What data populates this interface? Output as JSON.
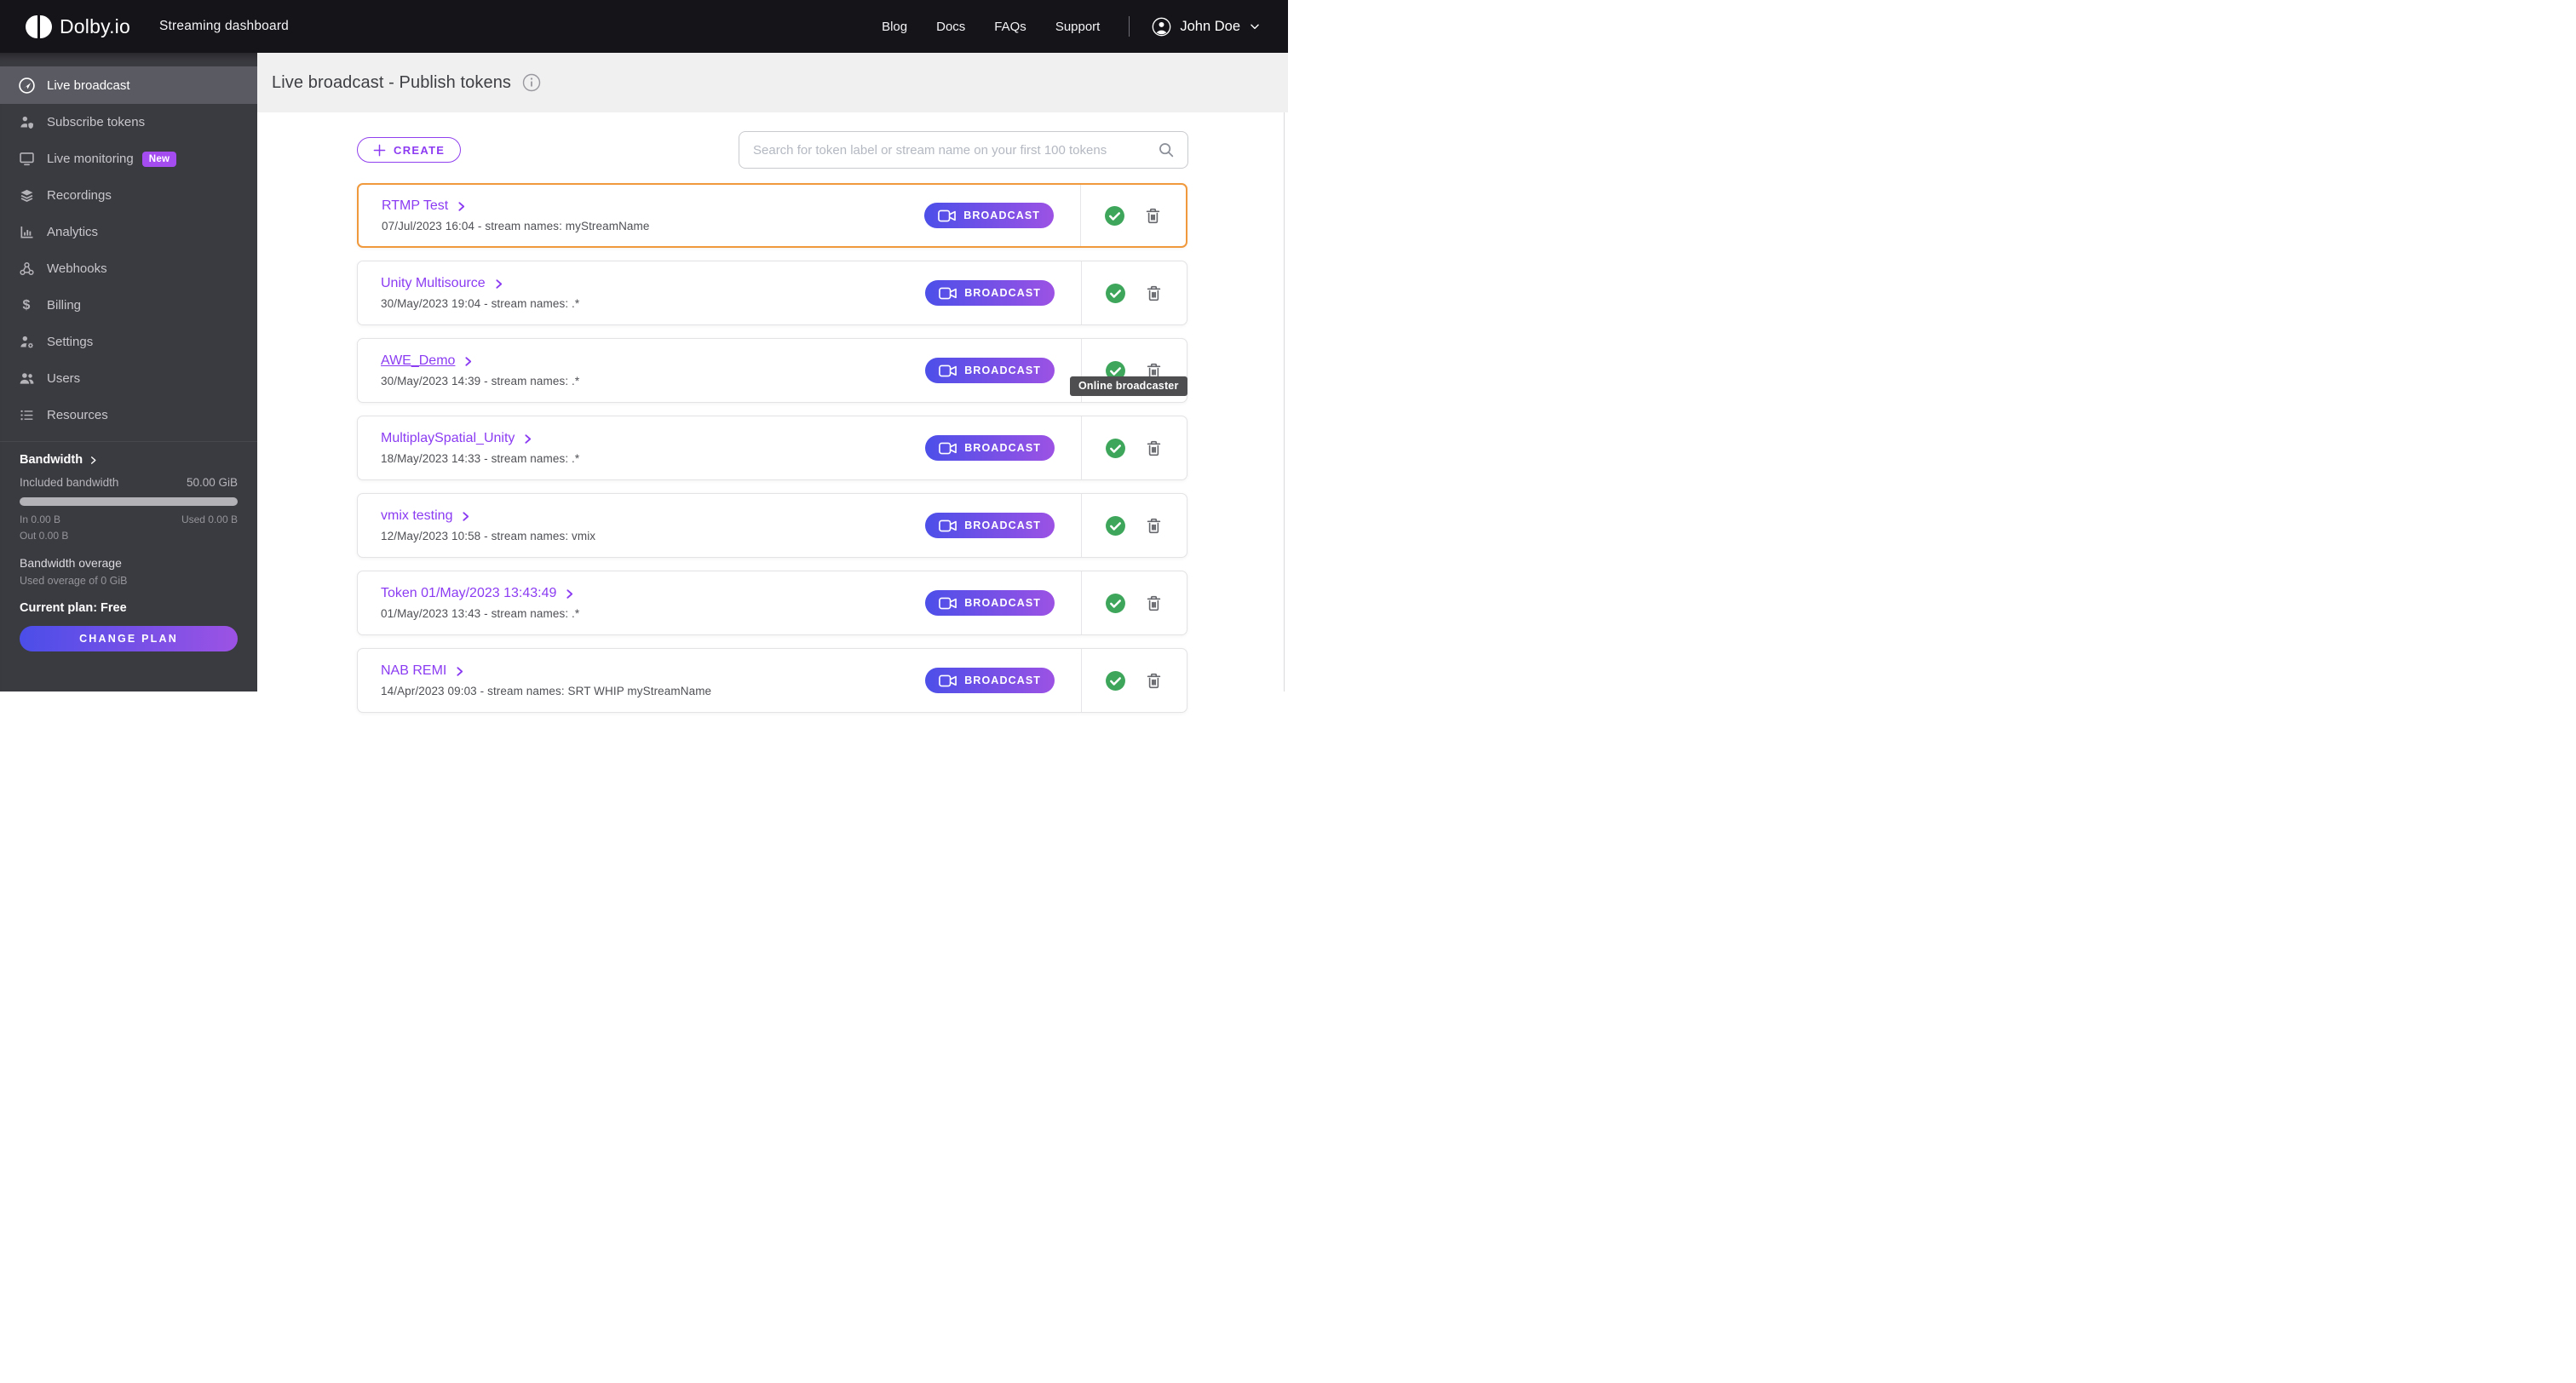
{
  "header": {
    "logo_text": "Dolby.io",
    "app_title": "Streaming dashboard",
    "nav": [
      {
        "label": "Blog"
      },
      {
        "label": "Docs"
      },
      {
        "label": "FAQs"
      },
      {
        "label": "Support"
      }
    ],
    "user": {
      "name": "John Doe"
    }
  },
  "sidebar": {
    "items": [
      {
        "label": "Live broadcast",
        "icon": "broadcast-icon",
        "active": true
      },
      {
        "label": "Subscribe tokens",
        "icon": "subscribe-tokens-icon"
      },
      {
        "label": "Live monitoring",
        "icon": "monitor-icon",
        "badge": "New"
      },
      {
        "label": "Recordings",
        "icon": "layers-icon"
      },
      {
        "label": "Analytics",
        "icon": "bar-chart-icon"
      },
      {
        "label": "Webhooks",
        "icon": "webhook-icon"
      },
      {
        "label": "Billing",
        "icon": "dollar-icon"
      },
      {
        "label": "Settings",
        "icon": "user-gear-icon"
      },
      {
        "label": "Users",
        "icon": "users-icon"
      },
      {
        "label": "Resources",
        "icon": "list-icon"
      }
    ],
    "bandwidth": {
      "title": "Bandwidth",
      "included_label": "Included bandwidth",
      "included_value": "50.00 GiB",
      "in_label": "In 0.00 B",
      "used_label": "Used 0.00 B",
      "out_label": "Out 0.00 B",
      "overage_title": "Bandwidth overage",
      "overage_detail": "Used overage of 0 GiB",
      "plan_label": "Current plan: Free",
      "change_plan_button": "CHANGE PLAN"
    }
  },
  "main": {
    "page_title": "Live broadcast - Publish tokens",
    "create_button": "CREATE",
    "search_placeholder": "Search for token label or stream name on your first 100 tokens",
    "broadcast_button": "BROADCAST",
    "tokens": [
      {
        "name": "RTMP Test",
        "details": "07/Jul/2023 16:04 - stream names: myStreamName",
        "highlighted": true
      },
      {
        "name": "Unity Multisource",
        "details": "30/May/2023 19:04 - stream names: .*"
      },
      {
        "name": "AWE_Demo",
        "details": "30/May/2023 14:39 - stream names: .*",
        "underlined": true,
        "tooltip": "Online broadcaster"
      },
      {
        "name": "MultiplaySpatial_Unity",
        "details": "18/May/2023 14:33 - stream names: .*"
      },
      {
        "name": "vmix testing",
        "details": "12/May/2023 10:58 - stream names: vmix"
      },
      {
        "name": "Token 01/May/2023 13:43:49",
        "details": "01/May/2023 13:43 - stream names: .*"
      },
      {
        "name": "NAB REMI",
        "details": "14/Apr/2023 09:03 - stream names: SRT WHIP myStreamName"
      }
    ]
  },
  "colors": {
    "accent_purple": "#8b3cf2",
    "gradient_start": "#4c4fe9",
    "gradient_end": "#9c52e4",
    "highlight_orange": "#f0993c",
    "status_green": "#3da65a",
    "badge_purple": "#a44cf0",
    "header_bg": "#141419",
    "sidebar_bg": "#3a3a41",
    "sidebar_active_bg": "#5a5a62",
    "titlebar_bg": "#f0f0f1"
  }
}
